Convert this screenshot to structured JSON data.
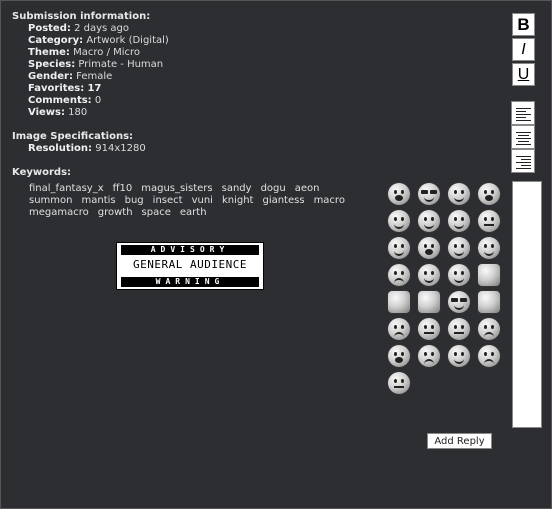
{
  "submission": {
    "heading": "Submission information:",
    "fields": [
      {
        "label": "Posted:",
        "value": "2 days ago"
      },
      {
        "label": "Category:",
        "value": "Artwork (Digital)"
      },
      {
        "label": "Theme:",
        "value": "Macro / Micro"
      },
      {
        "label": "Species:",
        "value": "Primate - Human"
      },
      {
        "label": "Gender:",
        "value": "Female"
      },
      {
        "label": "Favorites:",
        "value": "17"
      },
      {
        "label": "Comments:",
        "value": "0"
      },
      {
        "label": "Views:",
        "value": "180"
      }
    ]
  },
  "specs": {
    "heading": "Image Specifications:",
    "resolution_label": "Resolution:",
    "resolution_value": "914x1280"
  },
  "keywords": {
    "heading": "Keywords:",
    "items": [
      "final_fantasy_x",
      "ff10",
      "magus_sisters",
      "sandy",
      "dogu",
      "aeon",
      "summon",
      "mantis",
      "bug",
      "insect",
      "vuni",
      "knight",
      "giantess",
      "macro",
      "megamacro",
      "growth",
      "space",
      "earth"
    ]
  },
  "advisory": {
    "top": "ADVISORY",
    "middle": "GENERAL AUDIENCE",
    "bottom": "WARNING"
  },
  "toolbar": {
    "bold": "B",
    "italic": "I",
    "underline": "U"
  },
  "reply": {
    "button_label": "Add Reply",
    "value": ""
  },
  "smileys": [
    "tongue-smiley-icon",
    "cool-smiley-icon",
    "smile-smiley-icon",
    "surprised-smiley-icon",
    "happy-smiley-icon",
    "wink-smiley-icon",
    "smirk-smiley-icon",
    "confused-smiley-icon",
    "grin-smiley-icon",
    "angry-hair-smiley-icon",
    "laugh-smiley-icon",
    "eyeroll-smiley-icon",
    "frown-smiley-icon",
    "neutral-smiley-icon",
    "big-grin-smiley-icon",
    "gift-icon",
    "cup-icon",
    "heart-icon",
    "glasses-smiley-icon",
    "music-note-icon",
    "sad-smiley-icon",
    "flat-smiley-icon",
    "meh-smiley-icon",
    "upset-smiley-icon",
    "yawn-smiley-icon",
    "mad-smiley-icon",
    "beam-smiley-icon",
    "angry-smiley-icon",
    "grimace-smiley-icon"
  ]
}
